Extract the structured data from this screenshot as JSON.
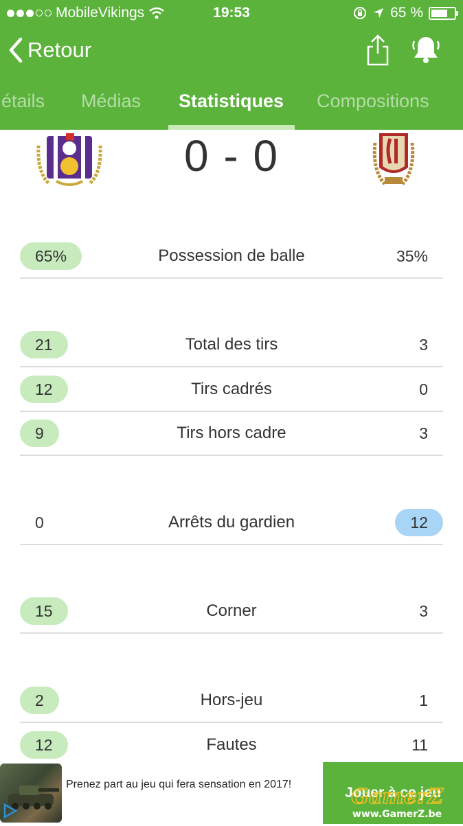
{
  "status_bar": {
    "carrier": "MobileVikings",
    "time": "19:53",
    "battery": "65 %"
  },
  "nav": {
    "back_label": "Retour"
  },
  "tabs": [
    {
      "label": "étails",
      "active": false
    },
    {
      "label": "Médias",
      "active": false
    },
    {
      "label": "Statistiques",
      "active": true
    },
    {
      "label": "Compositions",
      "active": false
    }
  ],
  "match": {
    "score": "0 - 0"
  },
  "stats": [
    {
      "label": "Possession de balle",
      "home": "65%",
      "away": "35%",
      "highlight": "home"
    },
    {
      "label": "Total des tirs",
      "home": "21",
      "away": "3",
      "highlight": "home"
    },
    {
      "label": "Tirs cadrés",
      "home": "12",
      "away": "0",
      "highlight": "home"
    },
    {
      "label": "Tirs hors cadre",
      "home": "9",
      "away": "3",
      "highlight": "home"
    },
    {
      "label": "Arrêts du gardien",
      "home": "0",
      "away": "12",
      "highlight": "away"
    },
    {
      "label": "Corner",
      "home": "15",
      "away": "3",
      "highlight": "home"
    },
    {
      "label": "Hors-jeu",
      "home": "2",
      "away": "1",
      "highlight": "home"
    },
    {
      "label": "Fautes",
      "home": "12",
      "away": "11",
      "highlight": "home"
    }
  ],
  "ad": {
    "text": "Prenez part au jeu qui fera sensation en 2017!",
    "button_label": "Jouer à ce jeu",
    "watermark_name": "GamerZ",
    "watermark_url": "www.GamerZ.be"
  },
  "colors": {
    "header_green": "#5bb33c",
    "home_pill": "#c7ebbd",
    "away_pill": "#a8d4f5"
  }
}
